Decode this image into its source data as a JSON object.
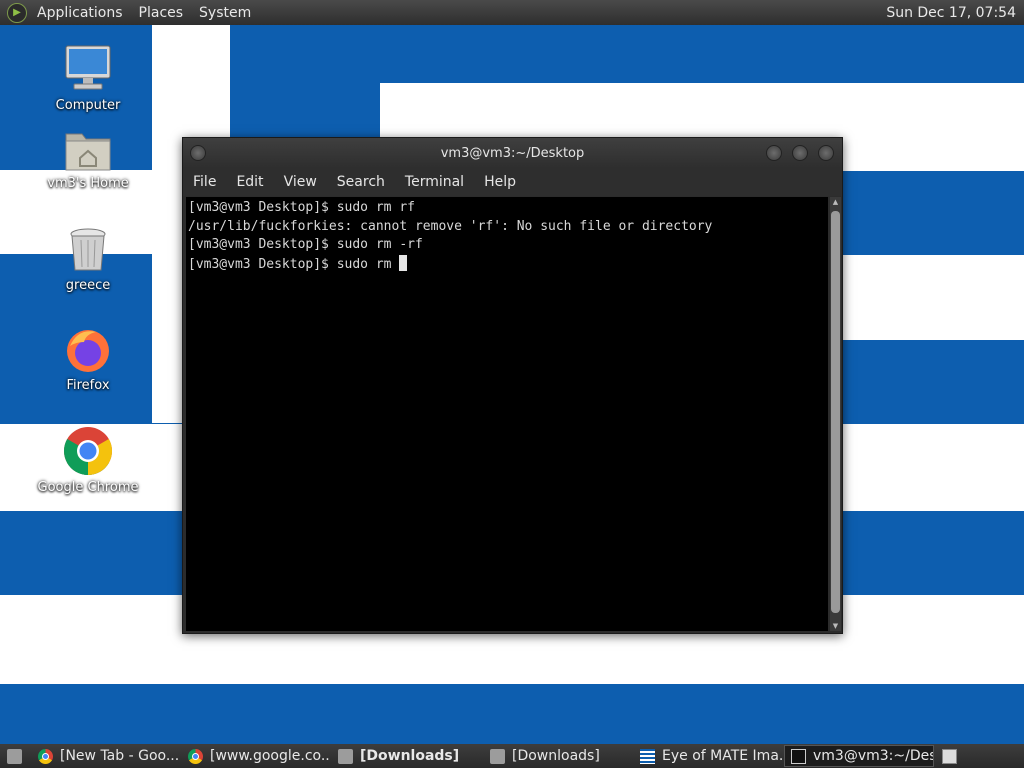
{
  "top_panel": {
    "menus": [
      "Applications",
      "Places",
      "System"
    ],
    "clock": "Sun Dec 17, 07:54"
  },
  "desktop": {
    "icons": [
      {
        "label": "Computer",
        "icon": "computer-icon"
      },
      {
        "label": "vm3's Home",
        "icon": "home-folder-icon"
      },
      {
        "label": "greece",
        "icon": "trash-icon"
      },
      {
        "label": "Firefox",
        "icon": "firefox-icon"
      },
      {
        "label": "Google Chrome",
        "icon": "chrome-icon"
      }
    ]
  },
  "terminal": {
    "title": "vm3@vm3:~/Desktop",
    "menus": [
      "File",
      "Edit",
      "View",
      "Search",
      "Terminal",
      "Help"
    ],
    "lines": [
      "[vm3@vm3 Desktop]$ sudo rm rf",
      "/usr/lib/fuckforkies: cannot remove 'rf': No such file or directory",
      "[vm3@vm3 Desktop]$ sudo rm -rf",
      "[vm3@vm3 Desktop]$ sudo rm "
    ]
  },
  "taskbar": {
    "tasks": [
      {
        "label": "[New Tab - Goo...",
        "icon": "chrome-icon",
        "bold": false,
        "active": false
      },
      {
        "label": "[www.google.co...",
        "icon": "chrome-icon",
        "bold": false,
        "active": false
      },
      {
        "label": "[Downloads]",
        "icon": "folder-icon",
        "bold": true,
        "active": false
      },
      {
        "label": "[Downloads]",
        "icon": "folder-icon",
        "bold": false,
        "active": false
      },
      {
        "label": "Eye of MATE Ima...",
        "icon": "greek-flag-icon",
        "bold": false,
        "active": false
      },
      {
        "label": "vm3@vm3:~/Des...",
        "icon": "terminal-icon",
        "bold": false,
        "active": true
      }
    ]
  },
  "colors": {
    "flag_blue": "#0d5eaf",
    "panel_bg": "#3a3a3a",
    "terminal_bg": "#000000"
  }
}
